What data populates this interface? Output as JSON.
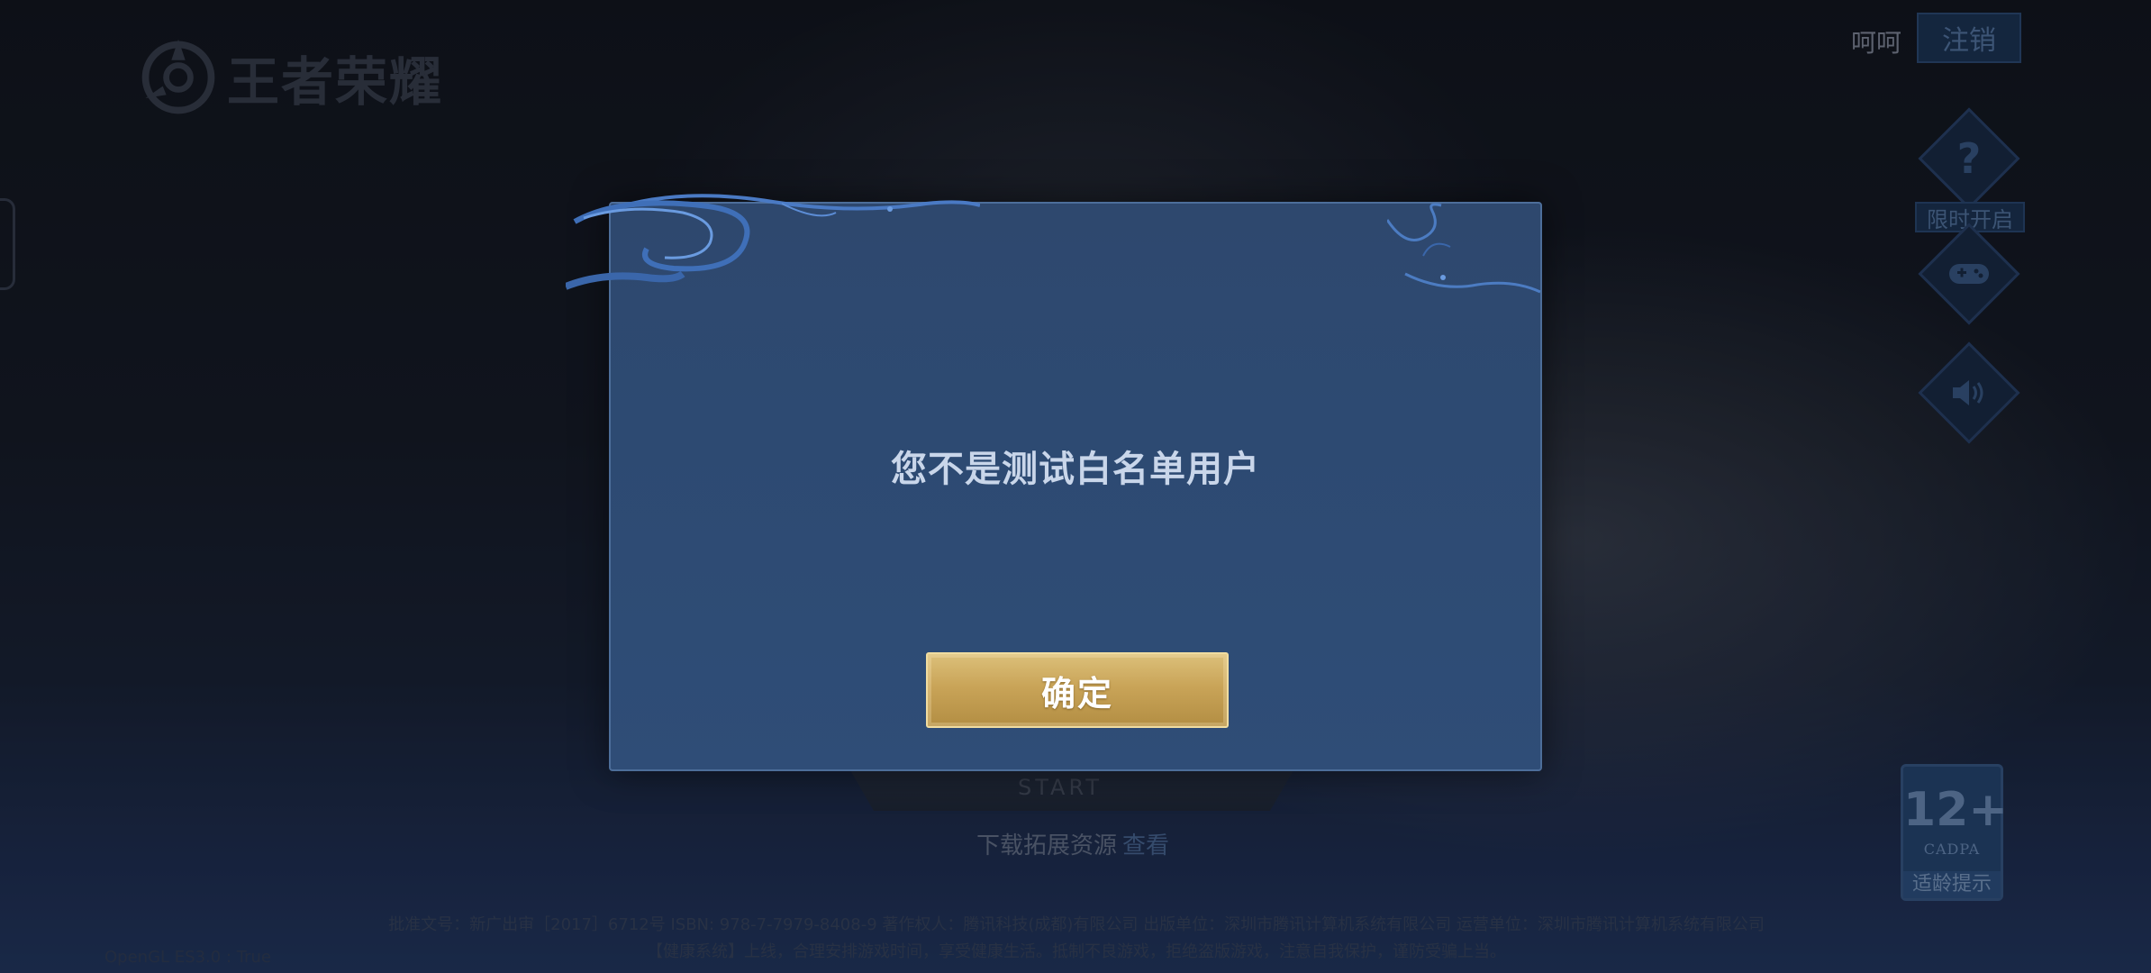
{
  "header": {
    "logo_text": "王者荣耀",
    "user_name": "呵呵",
    "logout_label": "注销"
  },
  "right_panel": {
    "help_icon": "question-icon",
    "limited_label": "限时开启",
    "gamepad_icon": "gamepad-icon",
    "sound_icon": "speaker-icon"
  },
  "age_rating": {
    "number": "12+",
    "org": "CADPA",
    "hint": "适龄提示"
  },
  "start": {
    "sub_label": "START"
  },
  "download": {
    "text": "下载拓展资源",
    "link": "查看"
  },
  "legal": {
    "line1": "批准文号：新广出审［2017］6712号 ISBN: 978-7-7979-8408-9 著作权人：腾讯科技(成都)有限公司 出版单位：深圳市腾讯计算机系统有限公司 运营单位：深圳市腾讯计算机系统有限公司",
    "line2": "【健康系统】上线，合理安排游戏时间，享受健康生活。抵制不良游戏，拒绝盗版游戏，注意自我保护，谨防受骗上当。"
  },
  "debug": {
    "opengl": "OpenGL ES3.0 : True"
  },
  "modal": {
    "message": "您不是测试白名单用户",
    "confirm_label": "确定"
  },
  "colors": {
    "modal_bg": "#2e486e",
    "confirm_gold": "#c9a458",
    "accent_blue": "#4f6f9e"
  }
}
